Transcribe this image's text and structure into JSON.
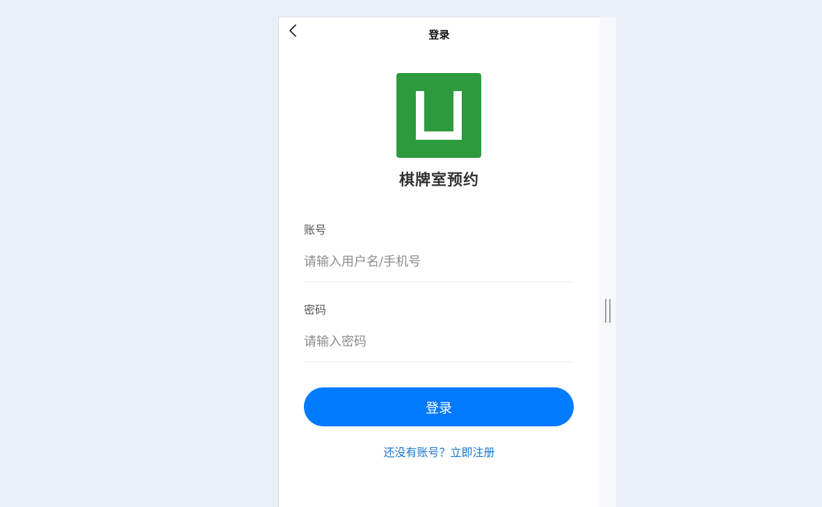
{
  "navbar": {
    "title": "登录",
    "back_icon": "chevron-left-icon"
  },
  "brand": {
    "app_name": "棋牌室预约",
    "logo_color": "#2d9a3d",
    "logo_icon": "u-shape-logo"
  },
  "form": {
    "account": {
      "label": "账号",
      "placeholder": "请输入用户名/手机号",
      "value": ""
    },
    "password": {
      "label": "密码",
      "placeholder": "请输入密码",
      "value": ""
    }
  },
  "actions": {
    "login_label": "登录",
    "login_color": "#007aff",
    "register_link": "还没有账号？立即注册",
    "register_color": "#1677d2"
  }
}
